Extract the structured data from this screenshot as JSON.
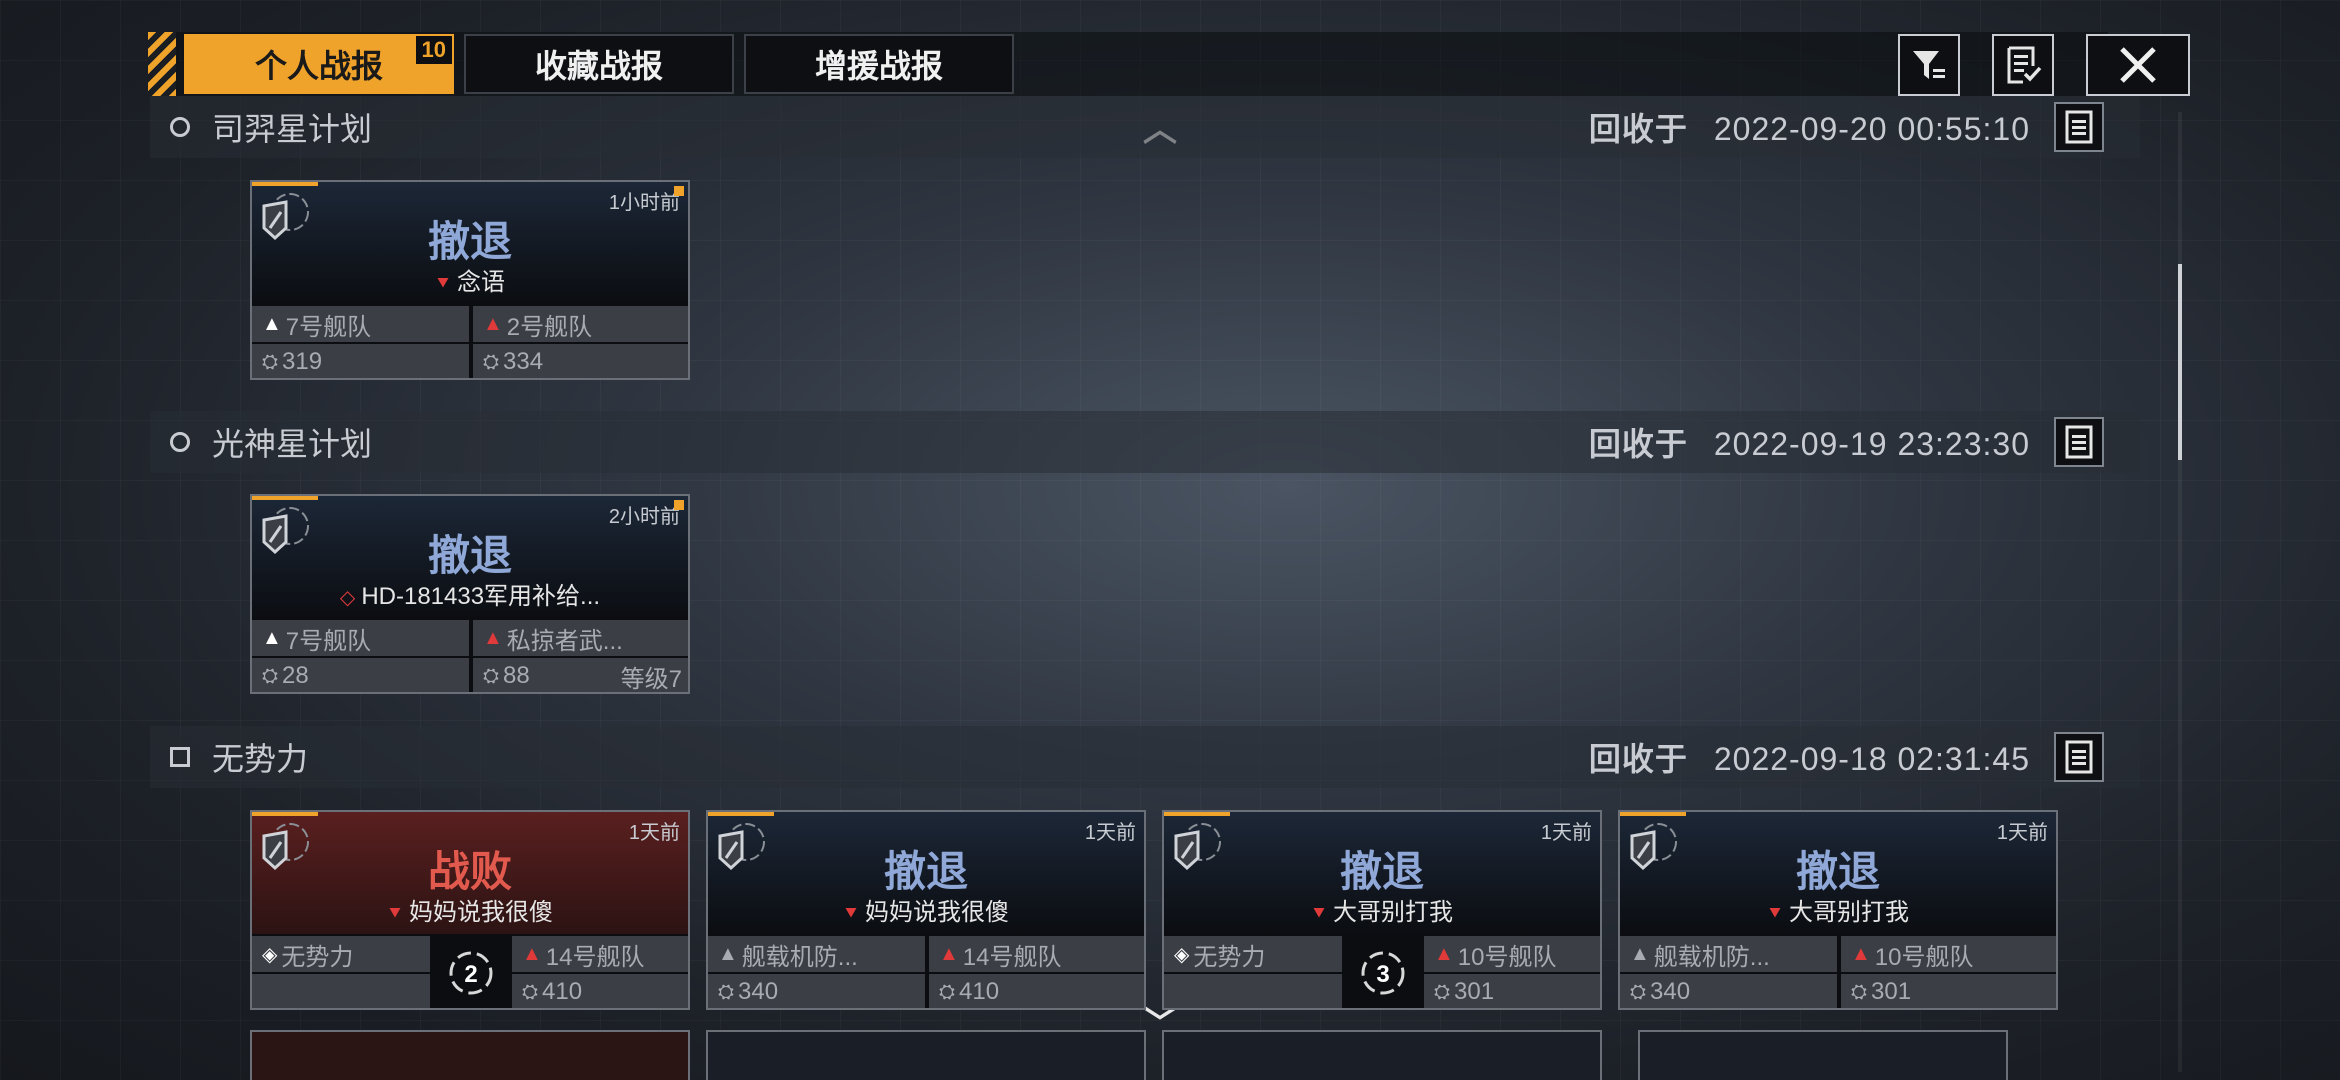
{
  "tabs": [
    {
      "label": "个人战报",
      "badge": "10"
    },
    {
      "label": "收藏战报"
    },
    {
      "label": "增援战报"
    }
  ],
  "toolbar": {
    "filter_icon": "filter-icon",
    "report_icon": "checklist-icon",
    "close_icon": "close-icon"
  },
  "sections": [
    {
      "title": "司羿星计划",
      "recycle_label": "回收于",
      "recycle_time": "2022-09-20 00:55:10",
      "cards": [
        {
          "time": "1小时前",
          "result": "撤退",
          "target": "念语",
          "left_fleet": "7号舰队",
          "right_fleet": "2号舰队",
          "left_power": "319",
          "right_power": "334"
        }
      ]
    },
    {
      "title": "光神星计划",
      "recycle_label": "回收于",
      "recycle_time": "2022-09-19 23:23:30",
      "cards": [
        {
          "time": "2小时前",
          "result": "撤退",
          "target": "HD-181433军用补给...",
          "left_fleet": "7号舰队",
          "right_fleet": "私掠者武...",
          "left_power": "28",
          "right_power": "88",
          "level": "等级7"
        }
      ]
    },
    {
      "title": "无势力",
      "recycle_label": "回收于",
      "recycle_time": "2022-09-18 02:31:45",
      "cards": [
        {
          "time": "1天前",
          "result": "战败",
          "target": "妈妈说我很傻",
          "left_fleet": "无势力",
          "right_fleet": "14号舰队",
          "right_power": "410",
          "round": "2"
        },
        {
          "time": "1天前",
          "result": "撤退",
          "target": "妈妈说我很傻",
          "left_fleet": "舰载机防...",
          "right_fleet": "14号舰队",
          "left_power": "340",
          "right_power": "410"
        },
        {
          "time": "1天前",
          "result": "撤退",
          "target": "大哥别打我",
          "left_fleet": "无势力",
          "right_fleet": "10号舰队",
          "right_power": "301",
          "round": "3"
        },
        {
          "time": "1天前",
          "result": "撤退",
          "target": "大哥别打我",
          "left_fleet": "舰载机防...",
          "right_fleet": "10号舰队",
          "left_power": "340",
          "right_power": "301"
        }
      ]
    }
  ],
  "colors": {
    "accent": "#f0a32a",
    "retreat": "#8fa8d8",
    "defeat": "#e25a4e",
    "enemy": "#e03a3a"
  }
}
